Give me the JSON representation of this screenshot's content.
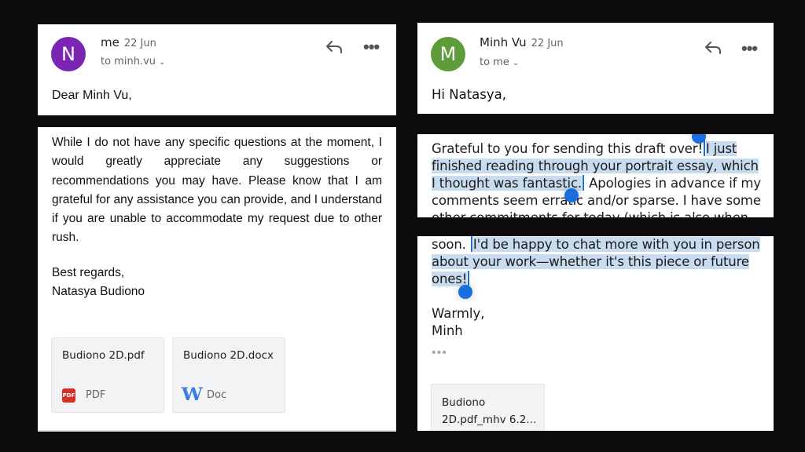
{
  "left_email": {
    "avatar_letter": "N",
    "avatar_color": "#7b25b5",
    "sender": "me",
    "date": "22 Jun",
    "recipient": "to minh.vu",
    "greeting": "Dear Minh Vu,",
    "body": "While I do not have any specific questions at the moment, I would greatly appreciate any suggestions or recommendations you may have. Please know that I am grateful for any assistance you can provide, and I understand if you are unable to accommodate my request due to other rush.",
    "signoff": "Best regards,",
    "signature": "Natasya Budiono",
    "attachments": [
      {
        "name": "Budiono 2D.pdf",
        "type": "PDF",
        "icon": "pdf-icon"
      },
      {
        "name": "Budiono 2D.docx",
        "type": "Doc",
        "icon": "word-doc-icon"
      }
    ]
  },
  "right_email": {
    "avatar_letter": "M",
    "avatar_color": "#5e9c3a",
    "sender": "Minh Vu",
    "date": "22 Jun",
    "recipient": "to me",
    "greeting": "Hi Natasya,",
    "para1_before": "Grateful to you for sending this draft over!",
    "para1_selected": "I just finished reading through your portrait essay, which I thought was fantastic.",
    "para1_after": "Apologies in advance if my comments seem erratic and/or sparse. I have some other commitments for today (which is also when",
    "para2_before": "soon.",
    "para2_selected": "I'd be happy to chat more with you in person about your work—whether it's this piece or future ones!",
    "signoff": "Warmly,",
    "signature": "Minh",
    "trimmed_content": "•••",
    "attachments": [
      {
        "name_line1": "Budiono",
        "name_line2": "2D.pdf_mhv 6.2..."
      }
    ]
  },
  "selection_color": "#c9dbee",
  "handle_color": "#1a6fe0"
}
